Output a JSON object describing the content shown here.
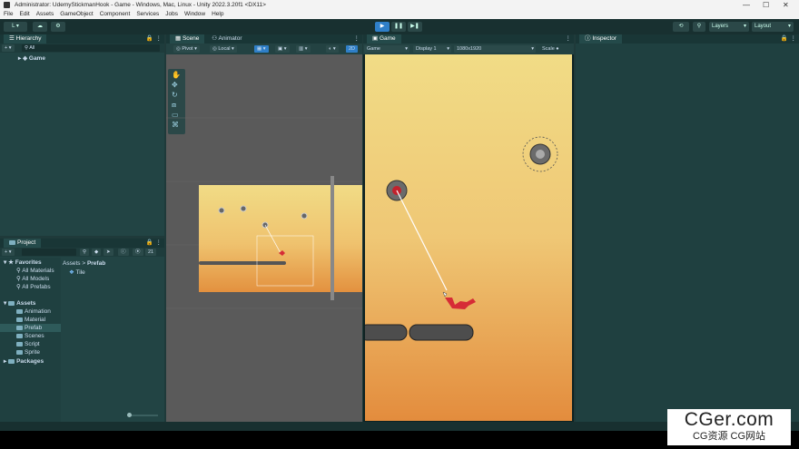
{
  "window": {
    "title": "Administrator: UdemyStickmanHook - Game - Windows, Mac, Linux - Unity 2022.3.20f1 <DX11>",
    "controls": [
      "—",
      "☐",
      "✕"
    ]
  },
  "menu": [
    "File",
    "Edit",
    "Assets",
    "GameObject",
    "Component",
    "Services",
    "Jobs",
    "Window",
    "Help"
  ],
  "toolbar": {
    "account_label": "L",
    "layers_label": "Layers",
    "layout_label": "Layout",
    "play_icon": "play-icon",
    "pause_icon": "pause-icon",
    "step_icon": "step-icon"
  },
  "hierarchy": {
    "tab": "Hierarchy",
    "search_placeholder": "All",
    "root": "Game"
  },
  "project": {
    "tab": "Project",
    "count": "21",
    "favorites_label": "Favorites",
    "favorites": [
      "All Materials",
      "All Models",
      "All Prefabs"
    ],
    "assets_label": "Assets",
    "asset_folders": [
      "Animation",
      "Material",
      "Prefab",
      "Scenes",
      "Script",
      "Sprite"
    ],
    "packages_label": "Packages",
    "breadcrumb": [
      "Assets",
      "Prefab"
    ],
    "breadcrumb_sep": ">",
    "items": [
      "Tile"
    ]
  },
  "scene": {
    "tabs": [
      "Scene",
      "Animator"
    ],
    "pivot": "Pivot",
    "local": "Local",
    "mode_2d": "2D"
  },
  "game": {
    "tab": "Game",
    "display_mode": "Game",
    "display": "Display 1",
    "resolution": "1080x1920",
    "scale_label": "Scale"
  },
  "inspector": {
    "tab": "Inspector"
  },
  "watermark": {
    "line1": "CGer.com",
    "line2": "CG资源 CG网站"
  }
}
